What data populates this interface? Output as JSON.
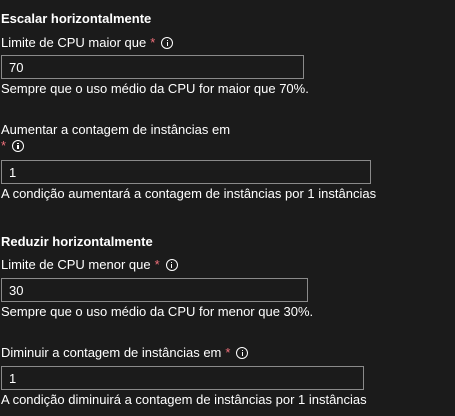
{
  "scale_out": {
    "heading": "Escalar horizontalmente",
    "cpu_threshold": {
      "label": "Limite de CPU maior que",
      "required_mark": "*",
      "value": "70",
      "help": "Sempre que o uso médio da CPU for maior que 70%."
    },
    "instance_increase": {
      "label": "Aumentar a contagem de instâncias em",
      "required_mark": "*",
      "value": "1",
      "help": "A condição aumentará a contagem de instâncias por 1 instâncias"
    }
  },
  "scale_in": {
    "heading": "Reduzir horizontalmente",
    "cpu_threshold": {
      "label": "Limite de CPU menor que",
      "required_mark": "*",
      "value": "30",
      "help": "Sempre que o uso médio da CPU for menor que 30%."
    },
    "instance_decrease": {
      "label": "Diminuir a contagem de instâncias em",
      "required_mark": "*",
      "value": "1",
      "help": "A condição diminuirá a contagem de instâncias por 1 instâncias"
    }
  },
  "icons": {
    "info": "info-icon"
  },
  "colors": {
    "background": "#1b1b1b",
    "text": "#ffffff",
    "required": "#f1707b",
    "field_border": "#8a8a8a"
  }
}
